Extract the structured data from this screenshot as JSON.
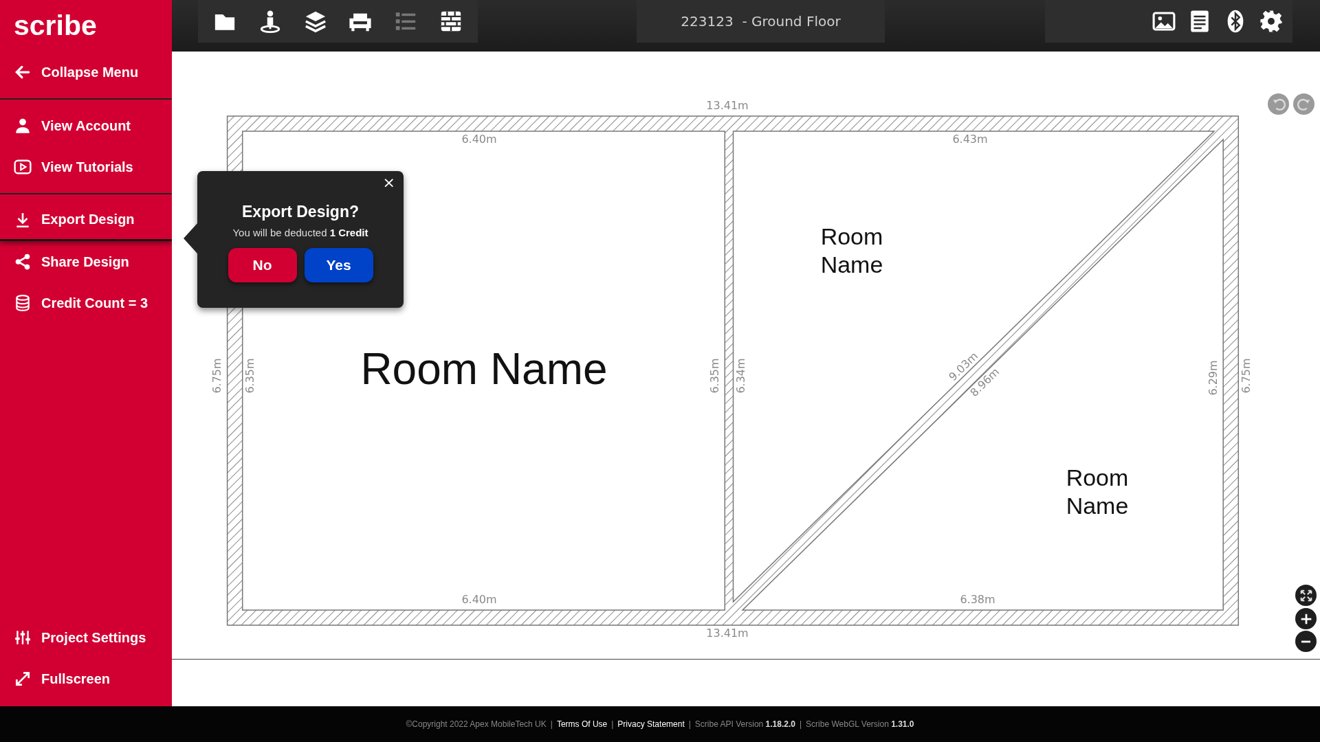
{
  "sidebar": {
    "logo": "scribe",
    "groups": [
      [
        {
          "label": "Collapse Menu",
          "selected": false
        }
      ],
      [
        {
          "label": "View Account",
          "selected": false
        },
        {
          "label": "View Tutorials",
          "selected": false
        }
      ],
      [
        {
          "label": "Export Design",
          "selected": true
        },
        {
          "label": "Share Design",
          "selected": false
        },
        {
          "label": "Credit Count = 3",
          "selected": false
        }
      ]
    ],
    "bottom_items": [
      {
        "label": "Project Settings",
        "selected": false
      },
      {
        "label": "Fullscreen",
        "selected": false
      }
    ]
  },
  "toolbar": {
    "tools": [
      {
        "disabled": false
      },
      {
        "disabled": false
      },
      {
        "disabled": false
      },
      {
        "disabled": false
      },
      {
        "disabled": true
      },
      {
        "disabled": false
      }
    ],
    "title": "223123  - Ground Floor"
  },
  "plan": {
    "overall_top": "13.41m",
    "overall_bottom": "13.41m",
    "overall_left": "6.75m",
    "overall_right": "6.75m",
    "rooms": [
      {
        "name": "Room Name",
        "top": "6.40m",
        "bottom": "6.40m",
        "left": "6.35m",
        "right": "6.35m"
      },
      {
        "name": "Room Name",
        "top": "6.43m",
        "left": "6.34m",
        "diagonal": "9.03m"
      },
      {
        "name": "Room Name",
        "bottom": "6.38m",
        "right": "6.29m",
        "diagonal": "8.96m"
      }
    ]
  },
  "dialog": {
    "title": "Export Design?",
    "message": "You will be deducted **1 Credit**",
    "buttons": [
      {
        "label": "No",
        "kind": "cancel"
      },
      {
        "label": "Yes",
        "kind": "confirm"
      }
    ],
    "close": "×"
  },
  "footer": [
    {
      "kind": "text",
      "text": "©Copyright 2022 Apex MobileTech UK"
    },
    {
      "kind": "separator",
      "text": "|"
    },
    {
      "kind": "link",
      "text": "Terms Of Use"
    },
    {
      "kind": "separator",
      "text": "|"
    },
    {
      "kind": "link",
      "text": "Privacy Statement"
    },
    {
      "kind": "separator",
      "text": "|"
    },
    {
      "kind": "text",
      "text": "Scribe API Version **1.18.2.0**"
    },
    {
      "kind": "separator",
      "text": "|"
    },
    {
      "kind": "text",
      "text": "Scribe WebGL Version **1.31.0**"
    }
  ]
}
